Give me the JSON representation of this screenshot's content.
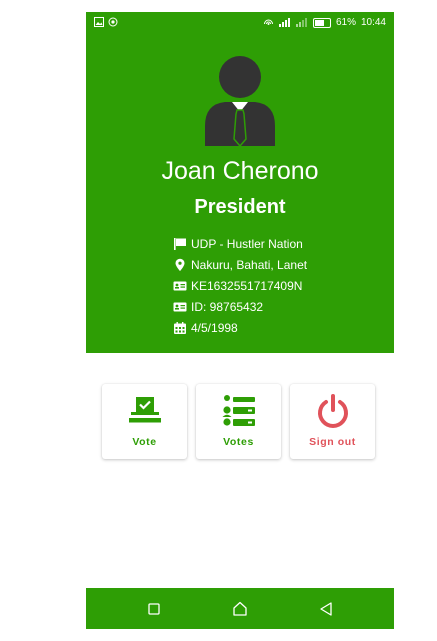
{
  "status_bar": {
    "battery": "61%",
    "time": "10:44",
    "icons": [
      "image-icon",
      "circle-icon",
      "hotspot-icon",
      "signal-icon",
      "signal-weak-icon",
      "battery-icon"
    ]
  },
  "profile": {
    "avatar_icon": "person-tie-icon",
    "name": "Joan Cherono",
    "role": "President",
    "details": [
      {
        "icon": "flag-icon",
        "text": "UDP - Hustler Nation"
      },
      {
        "icon": "location-pin-icon",
        "text": "Nakuru, Bahati, Lanet"
      },
      {
        "icon": "id-card-icon",
        "text": "KE1632551717409N"
      },
      {
        "icon": "id-card-icon",
        "text": "ID: 98765432"
      },
      {
        "icon": "calendar-icon",
        "text": "4/5/1998"
      }
    ]
  },
  "actions": [
    {
      "label": "Vote",
      "icon": "ballot-box-icon",
      "color": "#2e9e05"
    },
    {
      "label": "Votes",
      "icon": "list-icon",
      "color": "#2e9e05"
    },
    {
      "label": "Sign out",
      "icon": "power-icon",
      "color": "#e0525a"
    }
  ],
  "nav_bar": {
    "icons": [
      "recents-square-icon",
      "home-icon",
      "back-triangle-icon"
    ]
  },
  "colors": {
    "primary": "#2e9e05",
    "signout": "#e0525a",
    "avatar": "#333333"
  }
}
